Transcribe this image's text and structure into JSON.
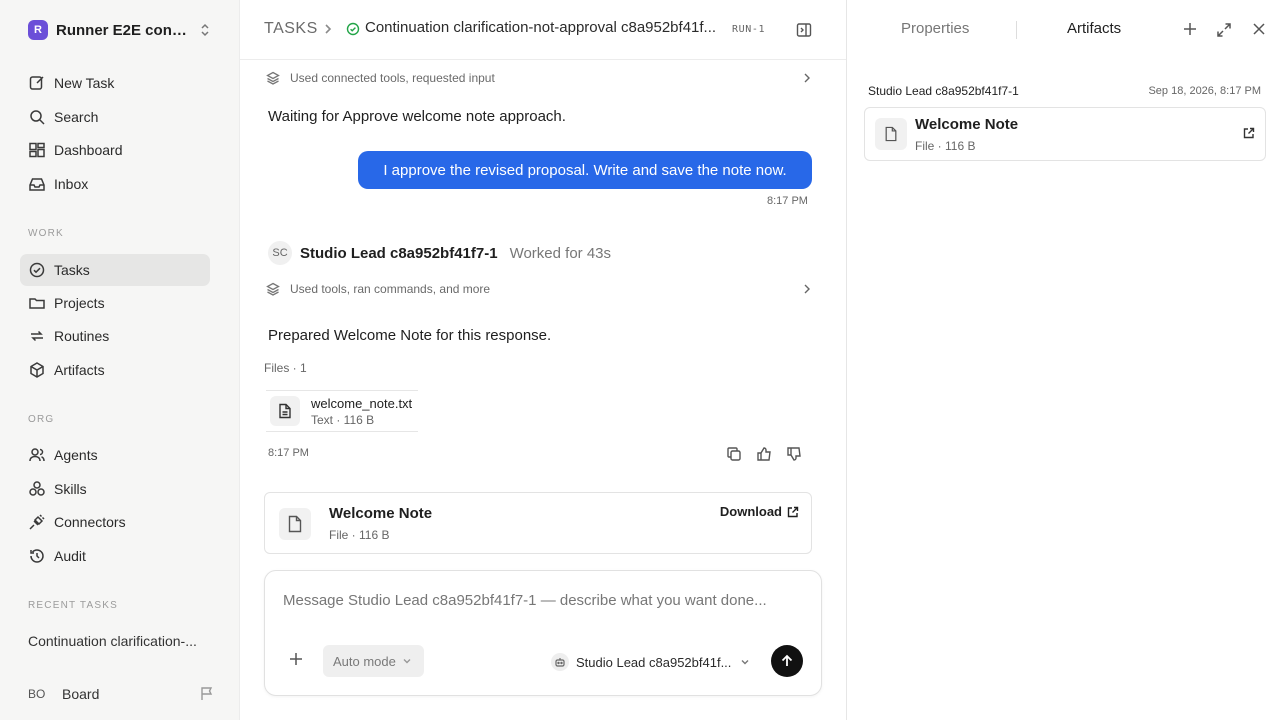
{
  "workspace": {
    "logo_letter": "R",
    "name": "Runner E2E conti..."
  },
  "nav": {
    "primary": [
      {
        "label": "New Task",
        "icon": "edit-icon"
      },
      {
        "label": "Search",
        "icon": "search-icon"
      },
      {
        "label": "Dashboard",
        "icon": "dashboard-icon"
      },
      {
        "label": "Inbox",
        "icon": "inbox-icon"
      }
    ],
    "work_label": "WORK",
    "work": [
      {
        "label": "Tasks",
        "icon": "check-circle-icon",
        "active": true
      },
      {
        "label": "Projects",
        "icon": "folder-icon"
      },
      {
        "label": "Routines",
        "icon": "repeat-icon"
      },
      {
        "label": "Artifacts",
        "icon": "box-icon"
      }
    ],
    "org_label": "ORG",
    "org": [
      {
        "label": "Agents",
        "icon": "users-icon"
      },
      {
        "label": "Skills",
        "icon": "skills-icon"
      },
      {
        "label": "Connectors",
        "icon": "plug-icon"
      },
      {
        "label": "Audit",
        "icon": "history-icon"
      }
    ],
    "recent_label": "RECENT TASKS",
    "recent": [
      "Continuation clarification-..."
    ]
  },
  "user": {
    "initials": "BO",
    "name": "Board"
  },
  "topbar": {
    "root": "TASKS",
    "title": "Continuation clarification-not-approval c8a952bf41f...",
    "run_badge": "RUN-1"
  },
  "thread": {
    "tool_row_1": "Used connected tools, requested input",
    "waiting_text": "Waiting for Approve welcome note approach.",
    "user_message": "I approve the revised proposal. Write and save the note now.",
    "user_time": "8:17 PM",
    "agent": {
      "initials": "SC",
      "name": "Studio Lead c8a952bf41f7-1",
      "worked": "Worked for 43s"
    },
    "tool_row_2": "Used tools, ran commands, and more",
    "reply_text": "Prepared Welcome Note for this response.",
    "files_label": "Files · 1",
    "file": {
      "name": "welcome_note.txt",
      "meta": "Text · 116 B"
    },
    "reply_time": "8:17 PM",
    "artifact": {
      "title": "Welcome Note",
      "meta": "File · 116 B",
      "download_label": "Download"
    }
  },
  "composer": {
    "placeholder": "Message Studio Lead c8a952bf41f7-1 — describe what you want done...",
    "mode": "Auto mode",
    "agent": "Studio Lead c8a952bf41f..."
  },
  "right_panel": {
    "tabs": [
      "Properties",
      "Artifacts"
    ],
    "active_tab": "Artifacts",
    "artifact_group": {
      "owner": "Studio Lead c8a952bf41f7-1",
      "date": "Sep 18, 2026, 8:17 PM",
      "item": {
        "title": "Welcome Note",
        "meta": "File · 116 B"
      }
    }
  },
  "colors": {
    "accent": "#2868e8",
    "workspace_logo": "#6b4fd8",
    "status_green": "#22a447",
    "send_button": "#111111"
  }
}
